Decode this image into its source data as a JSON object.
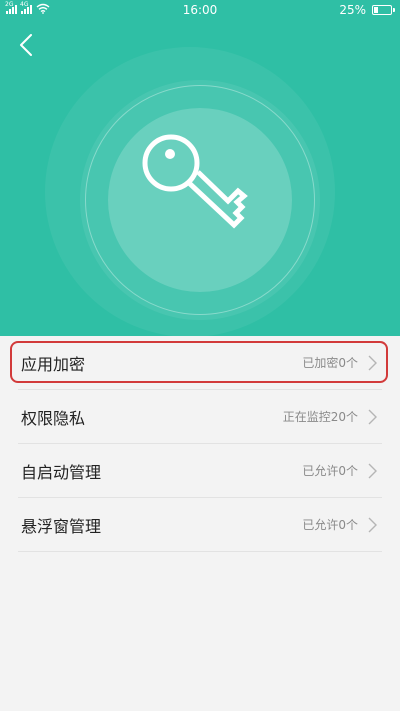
{
  "status_bar": {
    "sim1_tag": "2G",
    "sim2_tag": "4G",
    "time": "16:00",
    "battery_text": "25%",
    "battery_level_percent": 25
  },
  "header": {
    "back_icon": "chevron-left-icon",
    "hero_icon": "key-icon"
  },
  "colors": {
    "accent": "#2fbfa5",
    "highlight": "#d23a3a"
  },
  "settings": {
    "items": [
      {
        "label": "应用加密",
        "value": "已加密0个"
      },
      {
        "label": "权限隐私",
        "value": "正在监控20个"
      },
      {
        "label": "自启动管理",
        "value": "已允许0个"
      },
      {
        "label": "悬浮窗管理",
        "value": "已允许0个"
      }
    ]
  }
}
